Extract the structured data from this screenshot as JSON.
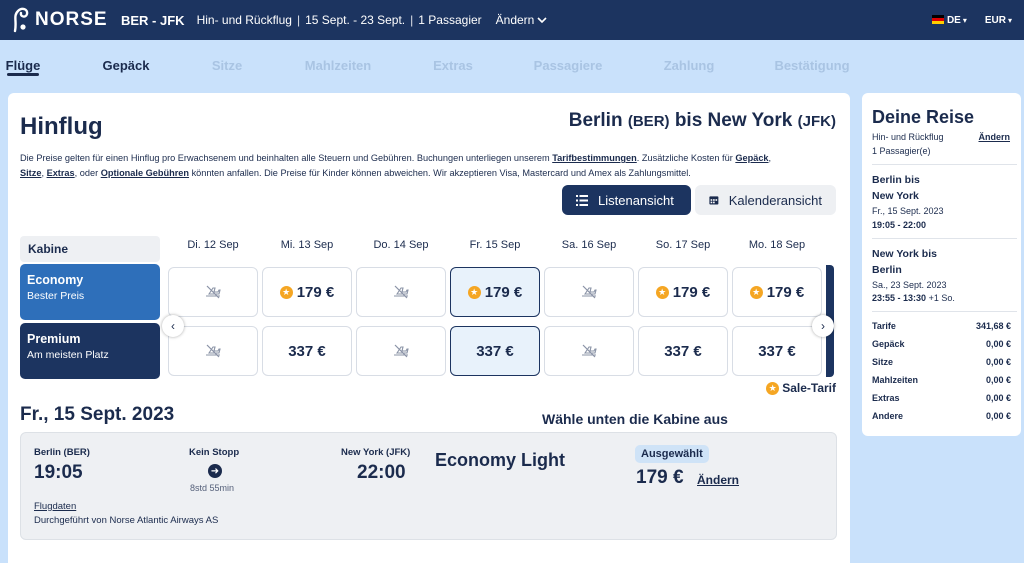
{
  "topbar": {
    "logo_text": "NORSE",
    "route": "BER - JFK",
    "trip_type": "Hin- und Rückflug",
    "dates": "15 Sept. - 23 Sept.",
    "passengers": "1 Passagier",
    "change_label": "Ändern",
    "language": "DE",
    "currency": "EUR"
  },
  "steps": [
    {
      "label": "Flüge",
      "state": "active"
    },
    {
      "label": "Gepäck",
      "state": "done"
    },
    {
      "label": "Sitze",
      "state": "pending"
    },
    {
      "label": "Mahlzeiten",
      "state": "pending"
    },
    {
      "label": "Extras",
      "state": "pending"
    },
    {
      "label": "Passagiere",
      "state": "pending"
    },
    {
      "label": "Zahlung",
      "state": "pending"
    },
    {
      "label": "Bestätigung",
      "state": "pending"
    }
  ],
  "main": {
    "title": "Hinflug",
    "route_from": "Berlin",
    "route_from_code": "(BER)",
    "route_mid": "bis",
    "route_to": "New York",
    "route_to_code": "(JFK)",
    "info_1": "Die Preise gelten für einen Hinflug pro Erwachsenem und beinhalten alle Steuern und Gebühren. Buchungen unterliegen unserem ",
    "info_link_tarif": "Tarifbestimmungen",
    "info_2": ". Zusätzliche Kosten für ",
    "info_link_gepaeck": "Gepäck",
    "info_3": ", ",
    "info_link_sitze": "Sitze",
    "info_4": ", ",
    "info_link_extras": "Extras",
    "info_5": ", oder ",
    "info_link_optional": "Optionale Gebühren",
    "info_6": " könnten anfallen. Die Preise für Kinder können abweichen. Wir akzeptieren Visa, Mastercard und Amex als Zahlungsmittel.",
    "list_view": "Listenansicht",
    "calendar_view": "Kalenderansicht",
    "kabine_header": "Kabine",
    "days": [
      "Di. 12 Sep",
      "Mi. 13 Sep",
      "Do. 14 Sep",
      "Fr. 15 Sep",
      "Sa. 16 Sep",
      "So. 17 Sep",
      "Mo. 18 Sep"
    ],
    "cabins": [
      {
        "name": "Economy",
        "sub": "Bester Preis"
      },
      {
        "name": "Premium",
        "sub": "Am meisten Platz"
      }
    ],
    "economy_prices": [
      "",
      "179 €",
      "",
      "179 €",
      "",
      "179 €",
      "179 €"
    ],
    "premium_prices": [
      "",
      "337 €",
      "",
      "337 €",
      "",
      "337 €",
      "337 €"
    ],
    "selected_day_index": 3,
    "sale_legend": "Sale-Tarif",
    "selected_date": "Fr., 15 Sept. 2023",
    "choose_cabin": "Wähle unten die Kabine aus",
    "flight": {
      "from_city": "Berlin (BER)",
      "dep_time": "19:05",
      "nonstop": "Kein Stopp",
      "duration": "8std 55min",
      "to_city": "New York (JFK)",
      "arr_time": "22:00",
      "details_link": "Flugdaten",
      "operated_by": "Durchgeführt von Norse Atlantic Airways AS",
      "fare_name": "Economy Light",
      "badge": "Ausgewählt",
      "price": "179 €",
      "change": "Ändern"
    }
  },
  "sidebar": {
    "title": "Deine Reise",
    "trip_type": "Hin- und Rückflug",
    "change": "Ändern",
    "passengers": "1 Passagier(e)",
    "outbound_line1": "Berlin bis",
    "outbound_line2": "New York",
    "outbound_date": "Fr., 15 Sept. 2023",
    "outbound_time": "19:05 - 22:00",
    "return_line1": "New York bis",
    "return_line2": "Berlin",
    "return_date": "Sa., 23 Sept. 2023",
    "return_time": "23:55 - 13:30",
    "return_plus": "+1 So.",
    "prices": [
      {
        "label": "Tarife",
        "value": "341,68 €"
      },
      {
        "label": "Gepäck",
        "value": "0,00 €"
      },
      {
        "label": "Sitze",
        "value": "0,00 €"
      },
      {
        "label": "Mahlzeiten",
        "value": "0,00 €"
      },
      {
        "label": "Extras",
        "value": "0,00 €"
      },
      {
        "label": "Andere",
        "value": "0,00 €"
      }
    ]
  },
  "colors": {
    "navy": "#1c3460",
    "economy_blue": "#2e6fba",
    "page_bg": "#c9e1fb",
    "sale_star": "#f5a623"
  }
}
